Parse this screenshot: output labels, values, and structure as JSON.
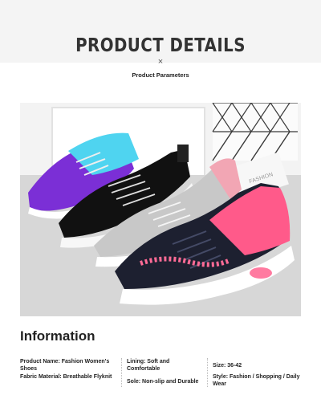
{
  "header": {
    "title": "PRODUCT DETAILS",
    "x_mark": "×",
    "subtitle": "Product Parameters"
  },
  "photo": {
    "box_text": "FASHION",
    "shoe_colors": [
      "#7b2fd6",
      "#4fd4f0",
      "#111111",
      "#c8c8c8",
      "#f2a6b4",
      "#ff5a8a",
      "#1d2030"
    ]
  },
  "information": {
    "heading": "Information",
    "specs": [
      {
        "text": "Product Name: Fashion Women's Shoes"
      },
      {
        "text": "Lining: Soft and Comfortable"
      },
      {
        "text": "Size: 36-42"
      },
      {
        "text": "Fabric Material: Breathable Flyknit"
      },
      {
        "text": "Sole: Non-slip and Durable"
      },
      {
        "text": "Style: Fashion / Shopping / Daily Wear"
      }
    ]
  }
}
